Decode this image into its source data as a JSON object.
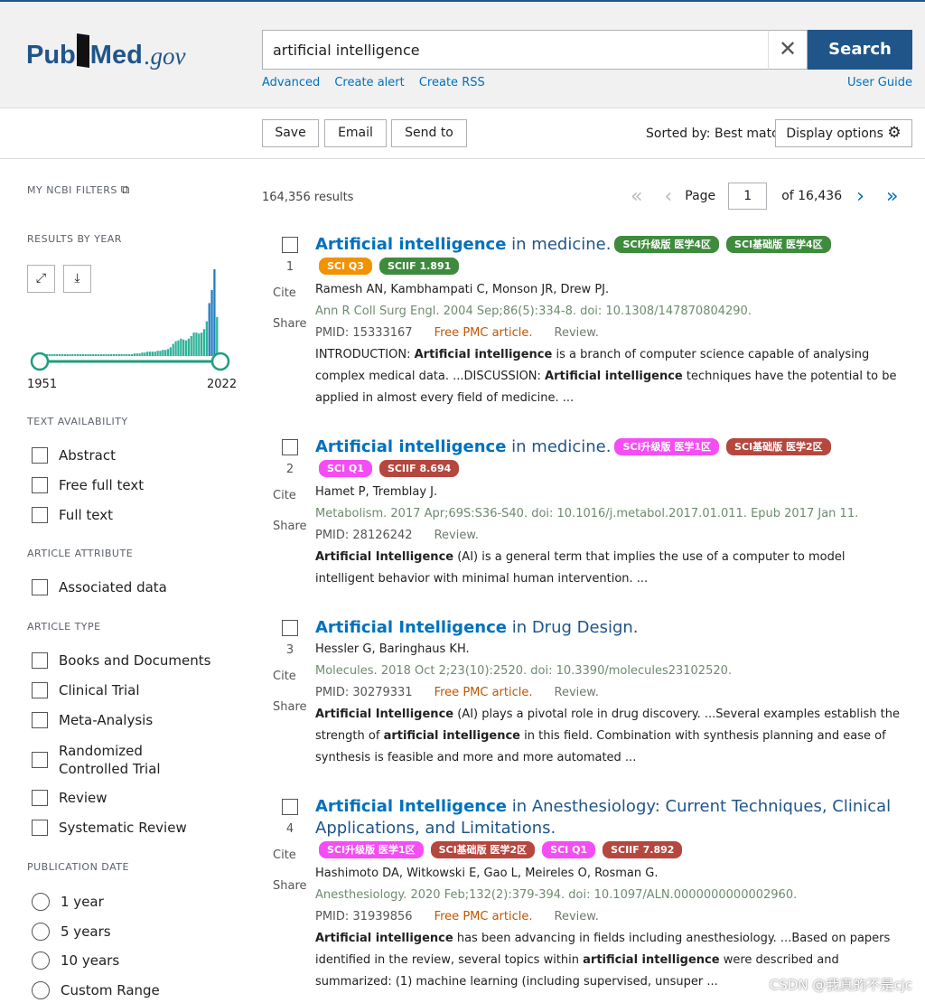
{
  "header": {
    "logo": {
      "left": "Pub",
      "right": "Med",
      ".gov": ".gov"
    },
    "search_value": "artificial intelligence",
    "search_button": "Search",
    "links": [
      "Advanced",
      "Create alert",
      "Create RSS"
    ],
    "user_guide": "User Guide"
  },
  "toolbar": {
    "save": "Save",
    "email": "Email",
    "send_to": "Send to",
    "sorted_by": "Sorted by: Best match",
    "display_options": "Display options"
  },
  "sidebar": {
    "my_ncbi_filters": "MY NCBI FILTERS",
    "results_by_year": "RESULTS BY YEAR",
    "year_start": "1951",
    "year_end": "2022",
    "histogram_relative": [
      1,
      1,
      1,
      1,
      1,
      1,
      1,
      1,
      1,
      1,
      1,
      1,
      1,
      1,
      1,
      1,
      1,
      1,
      1,
      1,
      1,
      1,
      1,
      1,
      1,
      1,
      1,
      1,
      1,
      1,
      1,
      1,
      2,
      2,
      2,
      2,
      3,
      3,
      3,
      4,
      4,
      5,
      5,
      5,
      5,
      6,
      6,
      7,
      7,
      8,
      10,
      14,
      17,
      18,
      20,
      19,
      18,
      20,
      23,
      27,
      27,
      26,
      27,
      31,
      40,
      61,
      76,
      100,
      45
    ],
    "text_availability": "TEXT AVAILABILITY",
    "text_options": [
      "Abstract",
      "Free full text",
      "Full text"
    ],
    "article_attribute": "ARTICLE ATTRIBUTE",
    "attribute_options": [
      "Associated data"
    ],
    "article_type": "ARTICLE TYPE",
    "type_options": [
      "Books and Documents",
      "Clinical Trial",
      "Meta-Analysis",
      "Randomized Controlled Trial",
      "Review",
      "Systematic Review"
    ],
    "publication_date": "PUBLICATION DATE",
    "date_options": [
      "1 year",
      "5 years",
      "10 years",
      "Custom Range"
    ]
  },
  "main": {
    "results_count": "164,356 results",
    "page_label": "Page",
    "page_value": "1",
    "page_of": "of 16,436",
    "cite": "Cite",
    "share": "Share",
    "results": [
      {
        "num": "1",
        "title_bold": "Artificial intelligence",
        "title_rest": " in medicine.",
        "badges": [
          {
            "text": "SCI升级版 医学4区",
            "color": "#3e8b3e"
          },
          {
            "text": "SCI基础版 医学4区",
            "color": "#3e8b3e"
          },
          {
            "text": "SCI Q3",
            "color": "#f39200"
          },
          {
            "text": "SCIIF 1.891",
            "color": "#3e8b3e"
          }
        ],
        "authors": "Ramesh AN, Kambhampati C, Monson JR, Drew PJ.",
        "citation": "Ann R Coll Surg Engl. 2004 Sep;86(5):334-8. doi: 10.1308/147870804290.",
        "pmid": "PMID: 15333167",
        "free": "Free PMC article.",
        "type": "Review.",
        "snippet": [
          {
            "t": "INTRODUCTION: "
          },
          {
            "t": "Artificial intelligence",
            "b": true
          },
          {
            "t": " is a branch of computer science capable of analysing complex medical data. ...DISCUSSION: "
          },
          {
            "t": "Artificial intelligence",
            "b": true
          },
          {
            "t": " techniques have the potential to be applied in almost every field of medicine. ..."
          }
        ]
      },
      {
        "num": "2",
        "title_bold": "Artificial intelligence",
        "title_rest": " in medicine.",
        "badges": [
          {
            "text": "SCI升级版 医学1区",
            "color": "#f54df5"
          },
          {
            "text": "SCI基础版 医学2区",
            "color": "#b5473f"
          },
          {
            "text": "SCI Q1",
            "color": "#f54df5"
          },
          {
            "text": "SCIIF 8.694",
            "color": "#b5473f"
          }
        ],
        "authors": "Hamet P, Tremblay J.",
        "citation": "Metabolism. 2017 Apr;69S:S36-S40. doi: 10.1016/j.metabol.2017.01.011. Epub 2017 Jan 11.",
        "pmid": "PMID: 28126242",
        "free": "",
        "type": "Review.",
        "snippet": [
          {
            "t": "Artificial Intelligence",
            "b": true
          },
          {
            "t": " (AI) is a general term that implies the use of a computer to model intelligent behavior with minimal human intervention. ..."
          }
        ]
      },
      {
        "num": "3",
        "title_bold": "Artificial Intelligence",
        "title_rest": " in Drug Design.",
        "badges": [],
        "authors": "Hessler G, Baringhaus KH.",
        "citation": "Molecules. 2018 Oct 2;23(10):2520. doi: 10.3390/molecules23102520.",
        "pmid": "PMID: 30279331",
        "free": "Free PMC article.",
        "type": "Review.",
        "snippet": [
          {
            "t": "Artificial Intelligence",
            "b": true
          },
          {
            "t": " (AI) plays a pivotal role in drug discovery. ...Several examples establish the strength of "
          },
          {
            "t": "artificial intelligence",
            "b": true
          },
          {
            "t": " in this field. Combination with synthesis planning and ease of synthesis is feasible and more and more automated ..."
          }
        ]
      },
      {
        "num": "4",
        "title_bold": "Artificial Intelligence",
        "title_rest": " in Anesthesiology: Current Techniques, Clinical Applications, and Limitations.",
        "badges": [
          {
            "text": "SCI升级版 医学1区",
            "color": "#f54df5"
          },
          {
            "text": "SCI基础版 医学2区",
            "color": "#b5473f"
          },
          {
            "text": "SCI Q1",
            "color": "#f54df5"
          },
          {
            "text": "SCIIF 7.892",
            "color": "#b5473f"
          }
        ],
        "authors": "Hashimoto DA, Witkowski E, Gao L, Meireles O, Rosman G.",
        "citation": "Anesthesiology. 2020 Feb;132(2):379-394. doi: 10.1097/ALN.0000000000002960.",
        "pmid": "PMID: 31939856",
        "free": "Free PMC article.",
        "type": "Review.",
        "snippet": [
          {
            "t": "Artificial intelligence",
            "b": true
          },
          {
            "t": " has been advancing in fields including anesthesiology. ...Based on papers identified in the review, several topics within "
          },
          {
            "t": "artificial intelligence",
            "b": true
          },
          {
            "t": " were described and summarized: (1) machine learning (including supervised, unsuper ..."
          }
        ]
      }
    ]
  },
  "watermark": "CSDN @我真的不是cjc"
}
